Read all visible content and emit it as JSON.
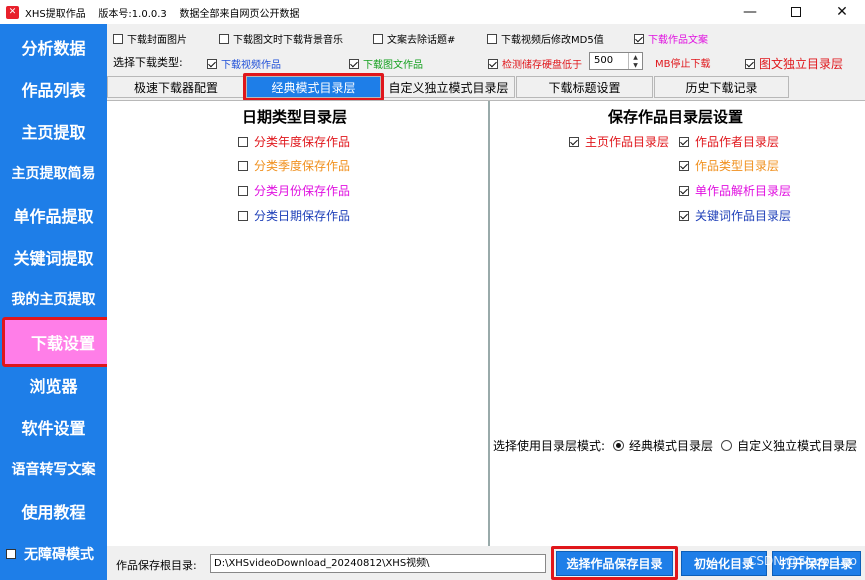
{
  "window": {
    "title": "XHS提取作品    版本号:1.0.0.3    数据全部来自网页公开数据",
    "icon_name": "app-logo",
    "controls": [
      "minimize",
      "maximize",
      "close"
    ]
  },
  "sidebar": {
    "items": [
      {
        "label": "分析数据"
      },
      {
        "label": "作品列表"
      },
      {
        "label": "主页提取"
      },
      {
        "label": "主页提取简易"
      },
      {
        "label": "单作品提取"
      },
      {
        "label": "关键词提取"
      },
      {
        "label": "我的主页提取"
      },
      {
        "label": "下载设置"
      },
      {
        "label": "浏览器"
      },
      {
        "label": "软件设置"
      },
      {
        "label": "语音转写文案"
      },
      {
        "label": "使用教程"
      }
    ],
    "active": "下载设置",
    "accessibility_toggle": {
      "label": "无障碍模式",
      "checked": false
    }
  },
  "options": {
    "row1": [
      {
        "label": "下载封面图片",
        "checked": false,
        "color": "#000000"
      },
      {
        "label": "下载图文时下载背景音乐",
        "checked": false,
        "color": "#000000"
      },
      {
        "label": "文案去除话题#",
        "checked": false,
        "color": "#000000"
      },
      {
        "label": "下载视频后修改MD5值",
        "checked": false,
        "color": "#000000"
      },
      {
        "label": "下载作品文案",
        "checked": true,
        "color": "#e010e0"
      }
    ],
    "type_label": "选择下载类型:",
    "row2": [
      {
        "label": "下载视频作品",
        "checked": true,
        "color": "#1e4fd8"
      },
      {
        "label": "下载图文作品",
        "checked": true,
        "color": "#14a01e"
      },
      {
        "label": "检测储存硬盘低于",
        "checked": true,
        "color": "#e0161b"
      },
      {
        "label": "图文独立目录层",
        "checked": true,
        "color": "#e0161b"
      }
    ],
    "disk_threshold": "500",
    "disk_unit_label": "MB停止下载"
  },
  "tabs": [
    {
      "label": "极速下载器配置"
    },
    {
      "label": "经典模式目录层"
    },
    {
      "label": "自定义独立模式目录层"
    },
    {
      "label": "下载标题设置"
    },
    {
      "label": "历史下载记录"
    }
  ],
  "active_tab": "经典模式目录层",
  "left_panel": {
    "title": "日期类型目录层",
    "items": [
      {
        "label": "分类年度保存作品",
        "checked": false,
        "color": "#e0161b"
      },
      {
        "label": "分类季度保存作品",
        "checked": false,
        "color": "#f0901e"
      },
      {
        "label": "分类月份保存作品",
        "checked": false,
        "color": "#e010e0"
      },
      {
        "label": "分类日期保存作品",
        "checked": false,
        "color": "#1e3fb8"
      }
    ]
  },
  "right_panel": {
    "title": "保存作品目录层设置",
    "items": [
      {
        "label": "主页作品目录层",
        "checked": true,
        "color": "#e0161b"
      },
      {
        "label": "作品作者目录层",
        "checked": true,
        "color": "#e0161b"
      },
      {
        "label": "作品类型目录层",
        "checked": true,
        "color": "#f0901e"
      },
      {
        "label": "单作品解析目录层",
        "checked": true,
        "color": "#e010e0"
      },
      {
        "label": "关键词作品目录层",
        "checked": true,
        "color": "#1e3fb8"
      }
    ],
    "mode_label": "选择使用目录层模式:",
    "modes": [
      {
        "label": "经典模式目录层",
        "selected": true
      },
      {
        "label": "自定义独立模式目录层",
        "selected": false
      }
    ]
  },
  "bottom": {
    "path_label": "作品保存根目录:",
    "path_value": "D:\\XHSvideoDownload_20240812\\XHS视频\\",
    "buttons": [
      {
        "label": "选择作品保存目录"
      },
      {
        "label": "初始化目录"
      },
      {
        "label": "打开保存目录"
      }
    ]
  },
  "watermark": "CSDN @Staro_Leo",
  "colors": {
    "accent": "#1e7ee8",
    "highlight": "#e0161b",
    "active_nav": "#ff7ee8"
  }
}
